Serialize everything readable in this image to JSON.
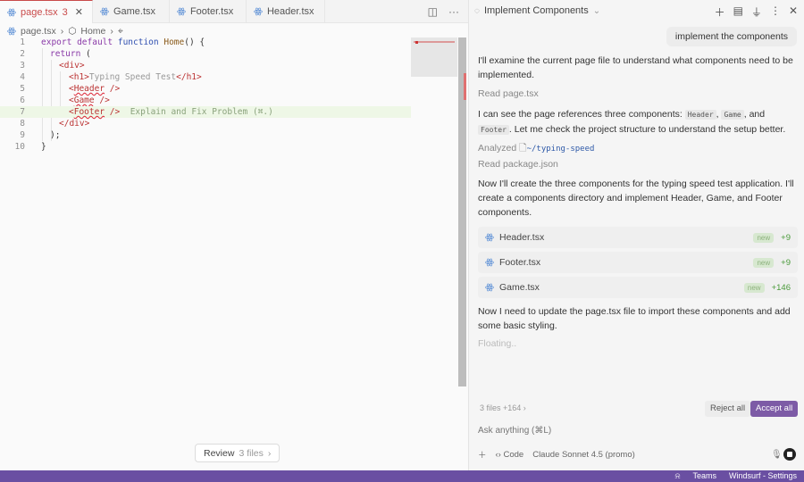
{
  "colors": {
    "accent": "#7d5ba6",
    "statusbar": "#6a4fa2",
    "error": "#c94a4a",
    "added": "#4a9a3a"
  },
  "tabs": [
    {
      "label": "page.tsx",
      "error_count": "3",
      "active": true
    },
    {
      "label": "Game.tsx"
    },
    {
      "label": "Footer.tsx"
    },
    {
      "label": "Header.tsx"
    }
  ],
  "breadcrumb": {
    "file": "page.tsx",
    "symbol": "Home"
  },
  "code": {
    "line_numbers": [
      "1",
      "2",
      "3",
      "4",
      "5",
      "6",
      "7",
      "8",
      "9",
      "10"
    ],
    "l1_kw1": "export",
    "l1_kw2": "default",
    "l1_kw3": "function",
    "l1_fn": "Home",
    "l1_rest": "() {",
    "l2_kw": "return",
    "l2_rest": " (",
    "l3": "<div>",
    "l4_open": "<h1>",
    "l4_text": "Typing Speed Test",
    "l4_close": "</h1>",
    "l5_tag": "Header",
    "l5_rest": " />",
    "l6_tag": "Game",
    "l6_rest": " />",
    "l7_tag": "Footer",
    "l7_rest": " />",
    "l7_hint": "Explain and Fix Problem (⌘.)",
    "l8": "</div>",
    "l9": ");",
    "l10": "}"
  },
  "review": {
    "label": "Review",
    "count": "3 files"
  },
  "chat": {
    "title": "Implement Components",
    "user_message": "implement the components",
    "msg1": "I'll examine the current page file to understand what components need to be implemented.",
    "step1": "Read page.tsx",
    "msg2_a": "I can see the page references three components: ",
    "chip1": "Header",
    "chip2": "Game",
    "msg2_b": ", and ",
    "chip3": "Footer",
    "msg2_c": ". Let me check the project structure to understand the setup better.",
    "step2_label": "Analyzed",
    "step2_path": "~/typing-speed",
    "step3": "Read package.json",
    "msg3": "Now I'll create the three components for the typing speed test application. I'll create a components directory and implement Header, Game, and Footer components.",
    "files": [
      {
        "name": "Header.tsx",
        "badge": "new",
        "added": "+9"
      },
      {
        "name": "Footer.tsx",
        "badge": "new",
        "added": "+9"
      },
      {
        "name": "Game.tsx",
        "badge": "new",
        "added": "+146"
      }
    ],
    "msg4": "Now I need to update the page.tsx file to import these components and add some basic styling.",
    "status": "Floating..",
    "summary": "3 files +164 ›",
    "reject_label": "Reject all",
    "accept_label": "Accept all",
    "input_placeholder": "Ask anything (⌘L)",
    "mode_label": "Code",
    "model_label": "Claude Sonnet 4.5 (promo)"
  },
  "statusbar": {
    "teams": "Teams",
    "app": "Windsurf - Settings"
  }
}
